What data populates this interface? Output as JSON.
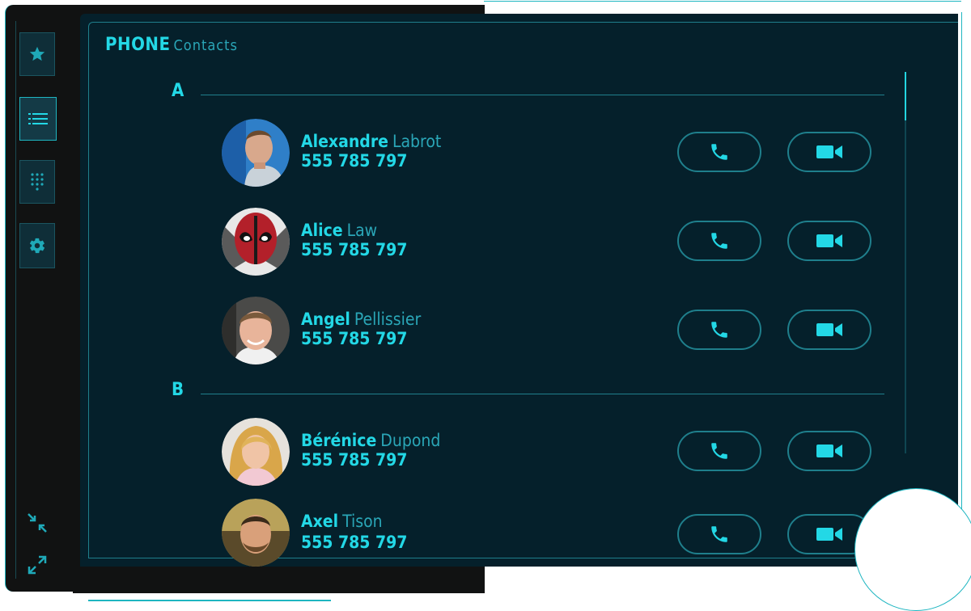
{
  "app": {
    "title": "PHONE",
    "subtitle": "Contacts"
  },
  "nav": [
    {
      "icon": "star-icon",
      "label": "Favorites"
    },
    {
      "icon": "list-icon",
      "label": "Contacts"
    },
    {
      "icon": "keypad-icon",
      "label": "Keypad"
    },
    {
      "icon": "gear-icon",
      "label": "Settings"
    }
  ],
  "sections": [
    {
      "letter": "A",
      "contacts": [
        {
          "first": "Alexandre",
          "last": "Labrot",
          "phone": "555 785 797"
        },
        {
          "first": "Alice",
          "last": "Law",
          "phone": "555 785 797"
        },
        {
          "first": "Angel",
          "last": "Pellissier",
          "phone": "555 785 797"
        }
      ]
    },
    {
      "letter": "B",
      "contacts": [
        {
          "first": "Bérénice",
          "last": "Dupond",
          "phone": "555 785 797"
        },
        {
          "first": "Axel",
          "last": "Tison",
          "phone": "555 785 797"
        }
      ]
    }
  ],
  "colors": {
    "accent": "#23d8e6",
    "muted": "#2aa6b7",
    "panel": "#05202b",
    "border": "#1f7f8c"
  }
}
